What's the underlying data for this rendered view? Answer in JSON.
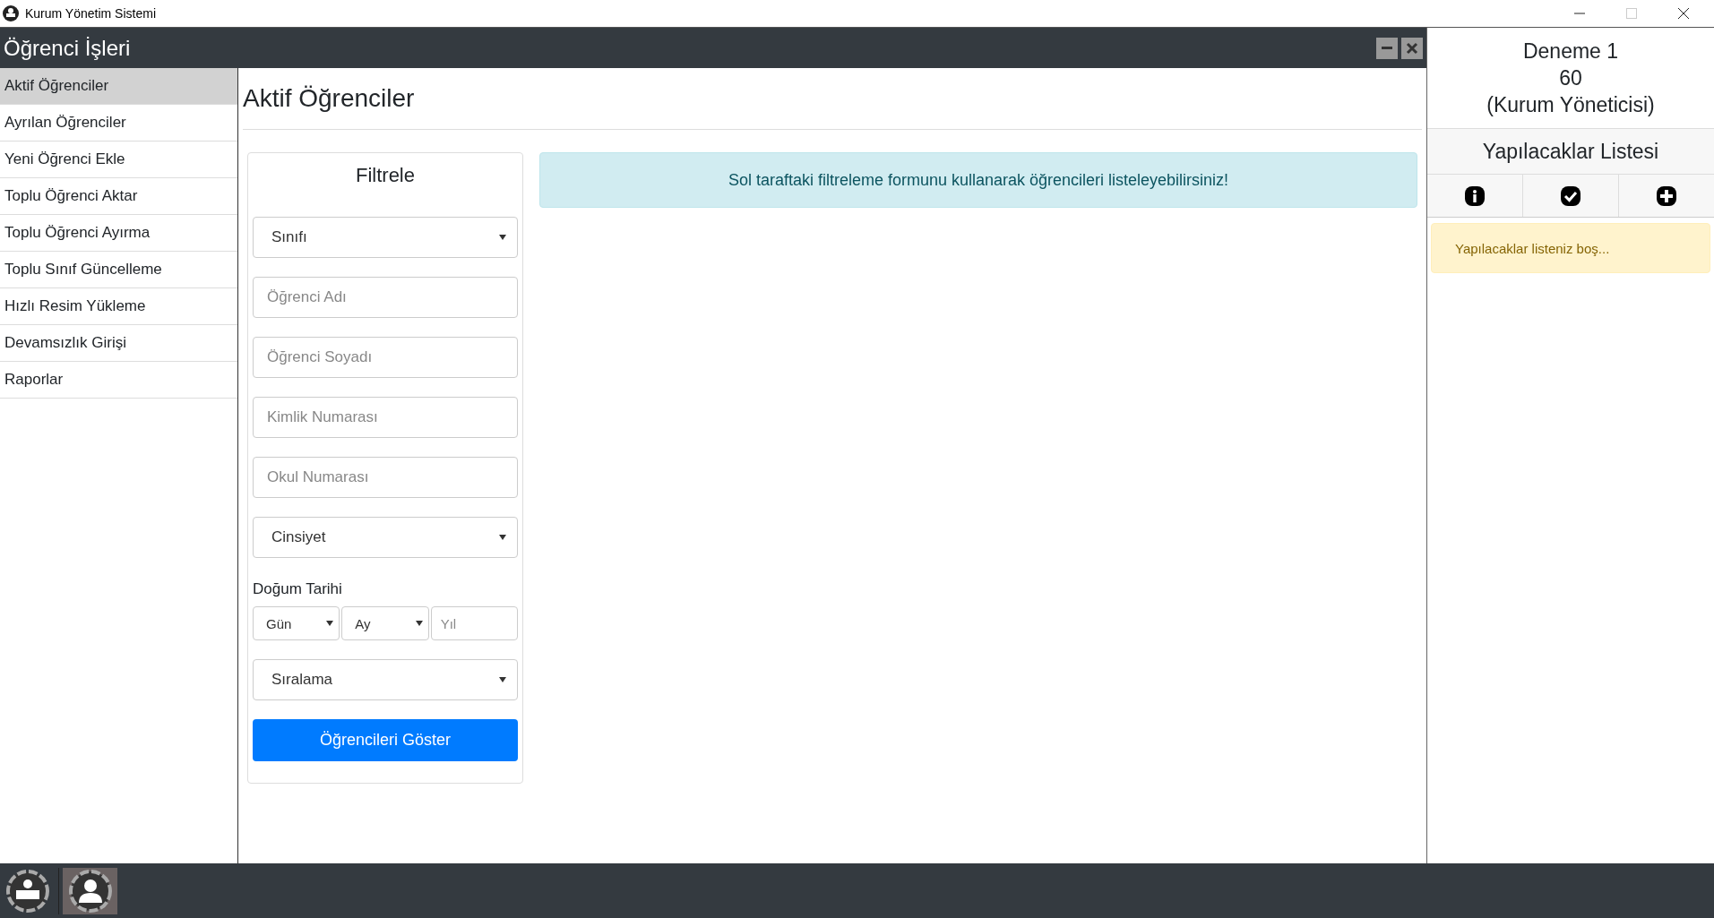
{
  "window": {
    "title": "Kurum Yönetim Sistemi"
  },
  "module": {
    "title": "Öğrenci İşleri"
  },
  "sidebar": {
    "items": [
      {
        "label": "Aktif Öğrenciler",
        "selected": true
      },
      {
        "label": "Ayrılan Öğrenciler",
        "selected": false
      },
      {
        "label": "Yeni Öğrenci Ekle",
        "selected": false
      },
      {
        "label": "Toplu Öğrenci Aktar",
        "selected": false
      },
      {
        "label": "Toplu Öğrenci Ayırma",
        "selected": false
      },
      {
        "label": "Toplu Sınıf Güncelleme",
        "selected": false
      },
      {
        "label": "Hızlı Resim Yükleme",
        "selected": false
      },
      {
        "label": "Devamsızlık Girişi",
        "selected": false
      },
      {
        "label": "Raporlar",
        "selected": false
      }
    ]
  },
  "page": {
    "heading": "Aktif Öğrenciler"
  },
  "filter": {
    "title": "Filtrele",
    "fields": [
      {
        "kind": "select",
        "text": "Sınıfı"
      },
      {
        "kind": "input",
        "placeholder": "Öğrenci Adı"
      },
      {
        "kind": "input",
        "placeholder": "Öğrenci Soyadı"
      },
      {
        "kind": "input",
        "placeholder": "Kimlik Numarası"
      },
      {
        "kind": "input",
        "placeholder": "Okul Numarası"
      },
      {
        "kind": "select",
        "text": "Cinsiyet"
      }
    ],
    "birth_label": "Doğum Tarihi",
    "birth_fields": [
      {
        "kind": "select",
        "text": "Gün"
      },
      {
        "kind": "select",
        "text": "Ay"
      },
      {
        "kind": "input",
        "placeholder": "Yıl"
      }
    ],
    "sort": {
      "kind": "select",
      "text": "Sıralama"
    },
    "button": "Öğrencileri Göster"
  },
  "info_alert": "Sol taraftaki filtreleme formunu kullanarak öğrencileri listeleyebilirsiniz!",
  "user": {
    "lines": [
      "Deneme 1",
      "60",
      "(Kurum Yöneticisi)"
    ]
  },
  "todo": {
    "title": "Yapılacaklar Listesi",
    "actions": [
      {
        "kind": "info"
      },
      {
        "kind": "check"
      },
      {
        "kind": "plus"
      }
    ],
    "empty_message": "Yapılacaklar listeniz boş..."
  },
  "taskbar": {
    "apps": [
      {
        "kind": "teacher",
        "selected": false
      },
      {
        "kind": "student",
        "selected": true
      }
    ]
  }
}
